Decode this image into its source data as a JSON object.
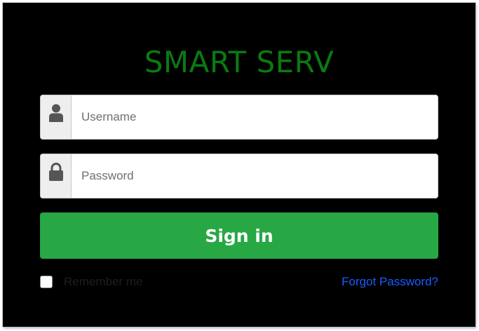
{
  "app": {
    "title": "SMART SERV"
  },
  "form": {
    "username": {
      "placeholder": "Username",
      "value": "",
      "icon": "user-icon"
    },
    "password": {
      "placeholder": "Password",
      "value": "",
      "icon": "lock-icon"
    },
    "signin_label": "Sign in",
    "remember_label": "Remember me",
    "remember_checked": false,
    "forgot_label": "Forgot Password?"
  },
  "colors": {
    "background": "#000000",
    "title": "#0a7a12",
    "primary_button": "#28a745",
    "link": "#1a5cff"
  }
}
